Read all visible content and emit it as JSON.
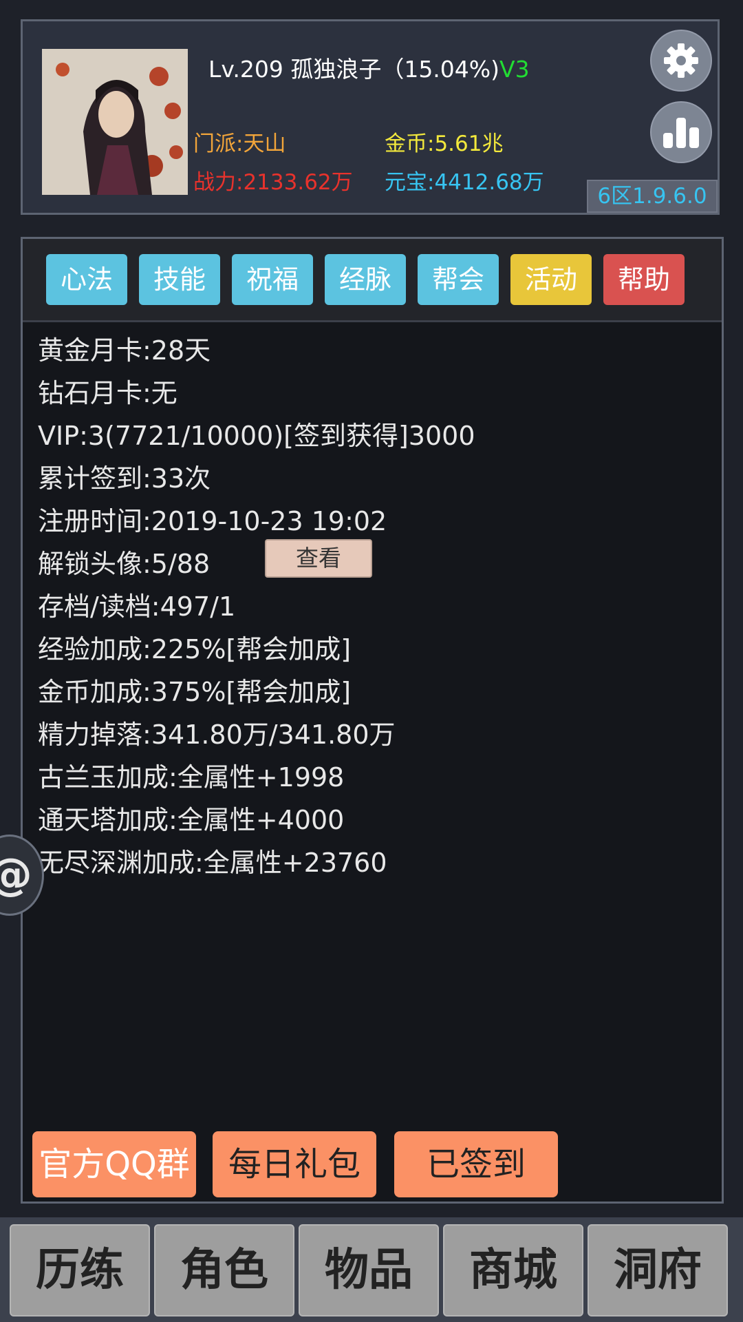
{
  "profile": {
    "level_name": "Lv.209 孤独浪子（15.04%)",
    "vip_tag": "V3",
    "sect": "门派:天山",
    "power": "战力:2133.62万",
    "gold": "金币:5.61兆",
    "ingot": "元宝:4412.68万",
    "version": "6区1.9.6.0",
    "settings_icon": "gear-icon",
    "ranking_icon": "bar-chart-icon"
  },
  "tabs": [
    {
      "label": "心法",
      "color": "#5cc3e0"
    },
    {
      "label": "技能",
      "color": "#5cc3e0"
    },
    {
      "label": "祝福",
      "color": "#5cc3e0"
    },
    {
      "label": "经脉",
      "color": "#5cc3e0"
    },
    {
      "label": "帮会",
      "color": "#5cc3e0"
    },
    {
      "label": "活动",
      "color": "#e8c63a"
    },
    {
      "label": "帮助",
      "color": "#d95250"
    }
  ],
  "info": {
    "gold_card": "黄金月卡:28天",
    "diamond_card": "钻石月卡:无",
    "vip": "VIP:3(7721/10000)[签到获得]3000",
    "signin_total": "累计签到:33次",
    "register_time": "注册时间:2019-10-23 19:02",
    "avatars_unlocked": "解锁头像:5/88",
    "view_button": "查看",
    "save_load": "存档/读档:497/1",
    "exp_bonus": "经验加成:225%[帮会加成]",
    "gold_bonus": "金币加成:375%[帮会加成]",
    "energy_drop": "精力掉落:341.80万/341.80万",
    "gulan_bonus": "古兰玉加成:全属性+1998",
    "tower_bonus": "通天塔加成:全属性+4000",
    "abyss_bonus": "无尽深渊加成:全属性+23760"
  },
  "actions": {
    "qq_group": "官方QQ群",
    "daily_gift": "每日礼包",
    "signed_in": "已签到"
  },
  "float_handle": "@",
  "nav": [
    "历练",
    "角色",
    "物品",
    "商城",
    "洞府"
  ]
}
